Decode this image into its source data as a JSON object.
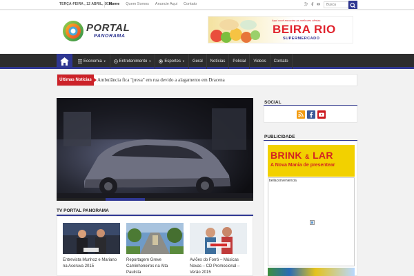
{
  "topbar": {
    "date": "Terça-feira , 12 Abril, 2016",
    "links": [
      {
        "label": "Home",
        "active": true
      },
      {
        "label": "Quem Somos",
        "active": false
      },
      {
        "label": "Anuncie Aqui",
        "active": false
      },
      {
        "label": "Contato",
        "active": false
      }
    ],
    "social_icons": [
      "rss-icon",
      "facebook-icon",
      "youtube-icon"
    ],
    "search_placeholder": "Busca"
  },
  "header": {
    "logo_line1": "PORTAL",
    "logo_line2": "PANORAMA",
    "banner": {
      "tagline": "Aqui você encontra as melhores ofertas",
      "brand": "BEIRA RIO",
      "sub": "SUPERMERCADO"
    }
  },
  "nav": {
    "home_icon": "home-icon",
    "items": [
      {
        "label": "Economia",
        "icon": "grid-icon",
        "dropdown": true
      },
      {
        "label": "Entretenimento",
        "icon": "clapper-icon",
        "dropdown": true
      },
      {
        "label": "Esportes",
        "icon": "ball-icon",
        "dropdown": true
      },
      {
        "label": "Geral",
        "icon": "",
        "dropdown": false
      },
      {
        "label": "Notícias",
        "icon": "",
        "dropdown": false
      },
      {
        "label": "Policial",
        "icon": "",
        "dropdown": false
      },
      {
        "label": "Videos",
        "icon": "",
        "dropdown": false
      },
      {
        "label": "Contato",
        "icon": "",
        "dropdown": false
      }
    ]
  },
  "ticker": {
    "label": "Últimas Notícias",
    "headline": "Ambulância fica \"presa\" em rua devido a alagamento em Dracena"
  },
  "tv": {
    "title": "TV Portal Panorama",
    "videos": [
      {
        "caption": "Entrevista Munhoz e Mariano na Aceruva 2015"
      },
      {
        "caption": "Reportagem Greve Caminhoneiros na Alta Paulista"
      },
      {
        "caption": "Aviões do Forró – Músicas Novas – CD Promocional – Verão 2015"
      }
    ]
  },
  "sidebar": {
    "social_title": "Social",
    "social_icons": [
      {
        "name": "rss-icon",
        "glyph": "◔",
        "color": "#f39c12"
      },
      {
        "name": "facebook-icon",
        "glyph": "f",
        "color": "#3b5998"
      },
      {
        "name": "youtube-icon",
        "glyph": "▶",
        "color": "#cc181e"
      }
    ],
    "pub_title": "Publicidade",
    "ad1_brand": "BRINK",
    "ad1_amp": "&",
    "ad1_brand2": "LAR",
    "ad1_slogan": "A Nova Mania de presentear",
    "ad2_text": "bellaconveniencia"
  },
  "colors": {
    "accent": "#2f3792",
    "ticker_red": "#cc2229",
    "nav_bg": "#2d2d2d"
  }
}
